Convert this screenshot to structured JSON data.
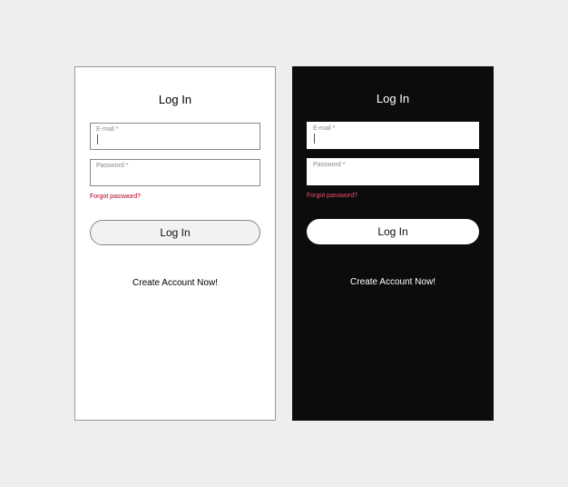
{
  "light": {
    "title": "Log In",
    "email_placeholder": "E-mail *",
    "password_placeholder": "Password *",
    "forgot": "Forgot password?",
    "login_button": "Log In",
    "create_account": "Create Account Now!"
  },
  "dark": {
    "title": "Log In",
    "email_placeholder": "E-mail *",
    "password_placeholder": "Password *",
    "forgot": "Forgot password?",
    "login_button": "Log In",
    "create_account": "Create Account Now!"
  }
}
